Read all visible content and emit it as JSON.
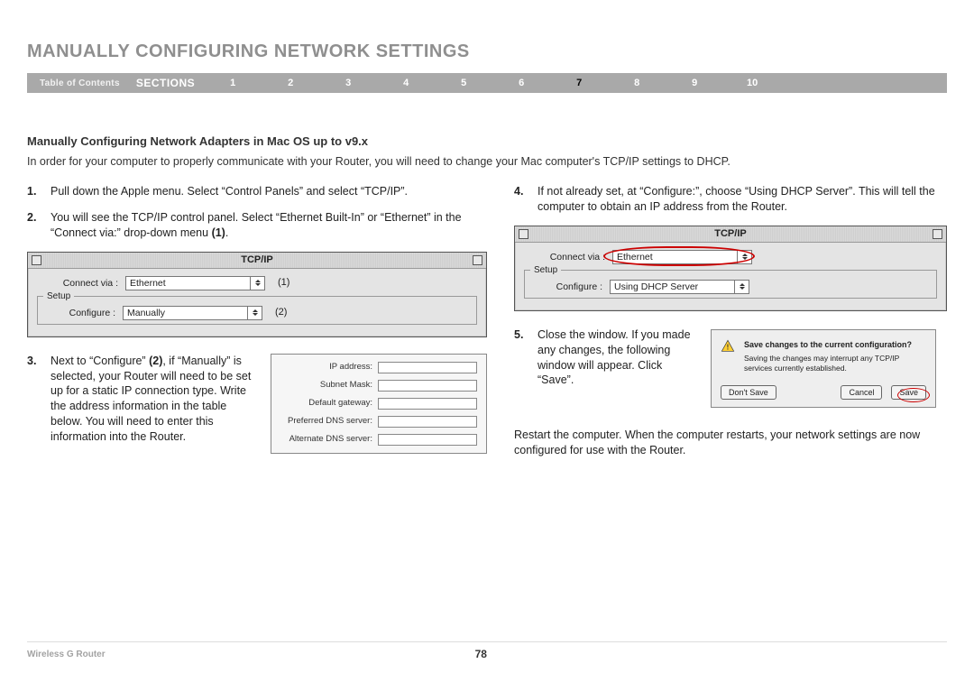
{
  "header": {
    "title": "MANUALLY CONFIGURING NETWORK SETTINGS"
  },
  "nav": {
    "toc": "Table of Contents",
    "sections_label": "SECTIONS",
    "items": [
      "1",
      "2",
      "3",
      "4",
      "5",
      "6",
      "7",
      "8",
      "9",
      "10"
    ],
    "active": "7"
  },
  "section": {
    "subheading": "Manually Configuring Network Adapters in Mac OS up to v9.x",
    "intro": "In order for your computer to properly communicate with your Router, you will need to change your Mac computer's TCP/IP settings to DHCP."
  },
  "left": {
    "step1_num": "1.",
    "step1_text": "Pull down the Apple menu. Select “Control Panels” and select “TCP/IP”.",
    "step2_num": "2.",
    "step2_text_a": "You will see the TCP/IP control panel. Select “Ethernet Built-In” or “Ethernet” in the “Connect via:” drop-down menu ",
    "step2_text_b": "(1)",
    "panel1": {
      "title": "TCP/IP",
      "connect_label": "Connect via :",
      "connect_value": "Ethernet",
      "marker1": "(1)",
      "setup_label": "Setup",
      "configure_label": "Configure :",
      "configure_value": "Manually",
      "marker2": "(2)"
    },
    "step3_num": "3.",
    "step3_text_a": "Next to “Configure” ",
    "step3_text_b": "(2)",
    "step3_text_c": ", if “Manually” is selected, your Router will need to be set up for a static IP connection type. Write the address information in the table below. You will need to enter this information into the Router.",
    "addr_table": {
      "ip": "IP address:",
      "mask": "Subnet Mask:",
      "gw": "Default gateway:",
      "dns1": "Preferred DNS server:",
      "dns2": "Alternate DNS server:"
    }
  },
  "right": {
    "step4_num": "4.",
    "step4_text": "If not already set, at “Configure:”, choose “Using DHCP Server”. This will tell the computer to obtain an IP address from the Router.",
    "panel2": {
      "title": "TCP/IP",
      "connect_label": "Connect via :",
      "connect_value": "Ethernet",
      "setup_label": "Setup",
      "configure_label": "Configure :",
      "configure_value": "Using DHCP Server"
    },
    "step5_num": "5.",
    "step5_text": "Close the window. If you made any changes, the following window will appear. Click “Save”.",
    "dialog": {
      "msg": "Save changes to the current configuration?",
      "sub": "Saving the changes may interrupt any TCP/IP services currently established.",
      "btn_dont": "Don't Save",
      "btn_cancel": "Cancel",
      "btn_save": "Save"
    },
    "restart_text": "Restart the computer. When the computer restarts, your network settings are now configured for use with the Router."
  },
  "footer": {
    "product": "Wireless G Router",
    "page": "78"
  }
}
